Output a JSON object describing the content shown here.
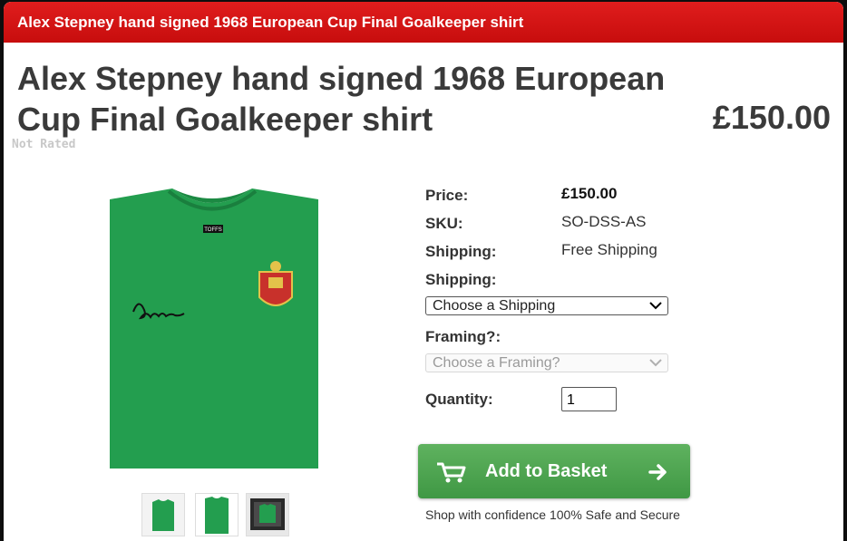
{
  "title_bar": {
    "text": "Alex Stepney hand signed 1968 European Cup Final Goalkeeper shirt"
  },
  "product": {
    "title": "Alex Stepney hand signed 1968 European Cup Final Goalkeeper shirt",
    "price_display": "£150.00",
    "rating_text": "Not Rated",
    "shirt_label_text": "TOFFS"
  },
  "details": {
    "price_label": "Price:",
    "price_value": "£150.00",
    "sku_label": "SKU:",
    "sku_value": "SO-DSS-AS",
    "shipping_label": "Shipping:",
    "shipping_value": "Free Shipping",
    "shipping_select_label": "Shipping:",
    "shipping_select_value": "Choose a Shipping",
    "framing_label": "Framing?:",
    "framing_select_value": "Choose a Framing?",
    "quantity_label": "Quantity:",
    "quantity_value": "1"
  },
  "actions": {
    "add_to_basket_label": "Add to Basket",
    "assurance_text": "Shop with confidence 100% Safe and Secure"
  },
  "colors": {
    "title_bar": "#d31414",
    "shirt_green": "#239e4f",
    "button_green": "#4fa84f"
  }
}
